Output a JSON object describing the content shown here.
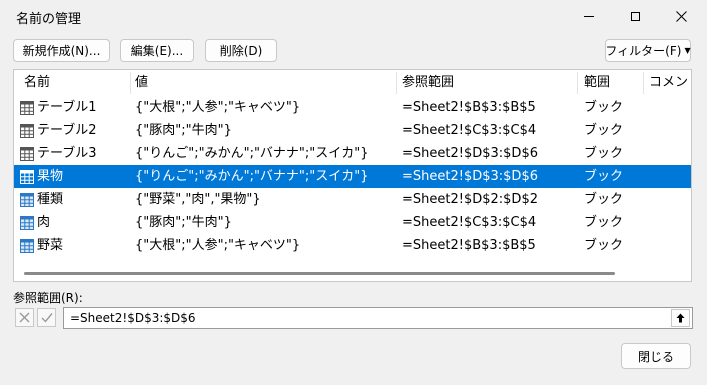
{
  "window": {
    "title": "名前の管理"
  },
  "toolbar": {
    "new_label": "新規作成(N)...",
    "edit_label": "編集(E)...",
    "delete_label": "削除(D)",
    "filter_label": "フィルター(F)"
  },
  "columns": [
    "名前",
    "値",
    "参照範囲",
    "範囲",
    "コメント"
  ],
  "rows": [
    {
      "name": "テーブル1",
      "value": "{\"大根\";\"人参\";\"キャベツ\"}",
      "ref": "=Sheet2!$B$3:$B$5",
      "scope": "ブック",
      "icon": "table-icon"
    },
    {
      "name": "テーブル2",
      "value": "{\"豚肉\";\"牛肉\"}",
      "ref": "=Sheet2!$C$3:$C$4",
      "scope": "ブック",
      "icon": "table-icon"
    },
    {
      "name": "テーブル3",
      "value": "{\"りんご\";\"みかん\";\"バナナ\";\"スイカ\"}",
      "ref": "=Sheet2!$D$3:$D$6",
      "scope": "ブック",
      "icon": "table-icon"
    },
    {
      "name": "果物",
      "value": "{\"りんご\";\"みかん\";\"バナナ\";\"スイカ\"}",
      "ref": "=Sheet2!$D$3:$D$6",
      "scope": "ブック",
      "icon": "named-range-icon",
      "selected": true
    },
    {
      "name": "種類",
      "value": "{\"野菜\",\"肉\",\"果物\"}",
      "ref": "=Sheet2!$D$2:$D$2",
      "scope": "ブック",
      "icon": "named-range-icon"
    },
    {
      "name": "肉",
      "value": "{\"豚肉\";\"牛肉\"}",
      "ref": "=Sheet2!$C$3:$C$4",
      "scope": "ブック",
      "icon": "named-range-icon"
    },
    {
      "name": "野菜",
      "value": "{\"大根\";\"人参\";\"キャベツ\"}",
      "ref": "=Sheet2!$B$3:$B$5",
      "scope": "ブック",
      "icon": "named-range-icon"
    }
  ],
  "refers_to": {
    "label": "参照範囲(R):",
    "value": "=Sheet2!$D$3:$D$6"
  },
  "footer": {
    "close_label": "閉じる"
  },
  "colors": {
    "selection": "#0078d7",
    "table_icon": "#555555",
    "named_icon": "#2b78c5"
  }
}
